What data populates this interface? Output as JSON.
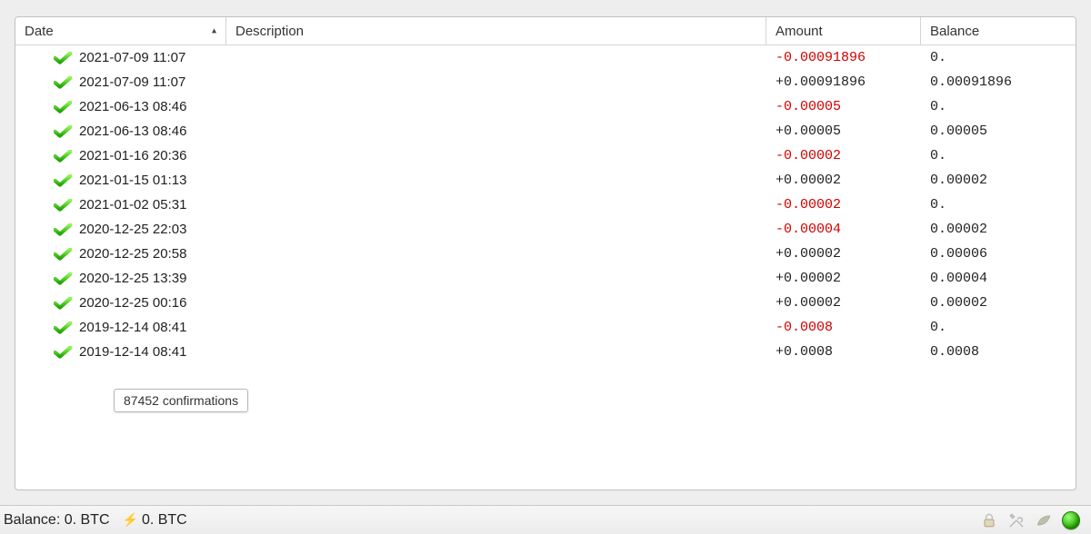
{
  "columns": {
    "date": "Date",
    "description": "Description",
    "amount": "Amount",
    "balance": "Balance"
  },
  "sort_indicator": "▴",
  "transactions": [
    {
      "date": "2021-07-09 11:07",
      "description": "",
      "amount": "-0.00091896",
      "negative": true,
      "balance": "0."
    },
    {
      "date": "2021-07-09 11:07",
      "description": "",
      "amount": "+0.00091896",
      "negative": false,
      "balance": "0.00091896"
    },
    {
      "date": "2021-06-13 08:46",
      "description": "",
      "amount": "-0.00005",
      "negative": true,
      "balance": "0."
    },
    {
      "date": "2021-06-13 08:46",
      "description": "",
      "amount": "+0.00005",
      "negative": false,
      "balance": "0.00005"
    },
    {
      "date": "2021-01-16 20:36",
      "description": "",
      "amount": "-0.00002",
      "negative": true,
      "balance": "0."
    },
    {
      "date": "2021-01-15 01:13",
      "description": "",
      "amount": "+0.00002",
      "negative": false,
      "balance": "0.00002"
    },
    {
      "date": "2021-01-02 05:31",
      "description": "",
      "amount": "-0.00002",
      "negative": true,
      "balance": "0."
    },
    {
      "date": "2020-12-25 22:03",
      "description": "",
      "amount": "-0.00004",
      "negative": true,
      "balance": "0.00002"
    },
    {
      "date": "2020-12-25 20:58",
      "description": "",
      "amount": "+0.00002",
      "negative": false,
      "balance": "0.00006"
    },
    {
      "date": "2020-12-25 13:39",
      "description": "",
      "amount": "+0.00002",
      "negative": false,
      "balance": "0.00004"
    },
    {
      "date": "2020-12-25 00:16",
      "description": "",
      "amount": "+0.00002",
      "negative": false,
      "balance": "0.00002"
    },
    {
      "date": "2019-12-14 08:41",
      "description": "",
      "amount": "-0.0008",
      "negative": true,
      "balance": "0."
    },
    {
      "date": "2019-12-14 08:41",
      "description": "",
      "amount": "+0.0008",
      "negative": false,
      "balance": "0.0008"
    }
  ],
  "tooltip": "87452 confirmations",
  "status": {
    "balance_label": "Balance: 0. BTC",
    "lightning_label": "0. BTC"
  }
}
